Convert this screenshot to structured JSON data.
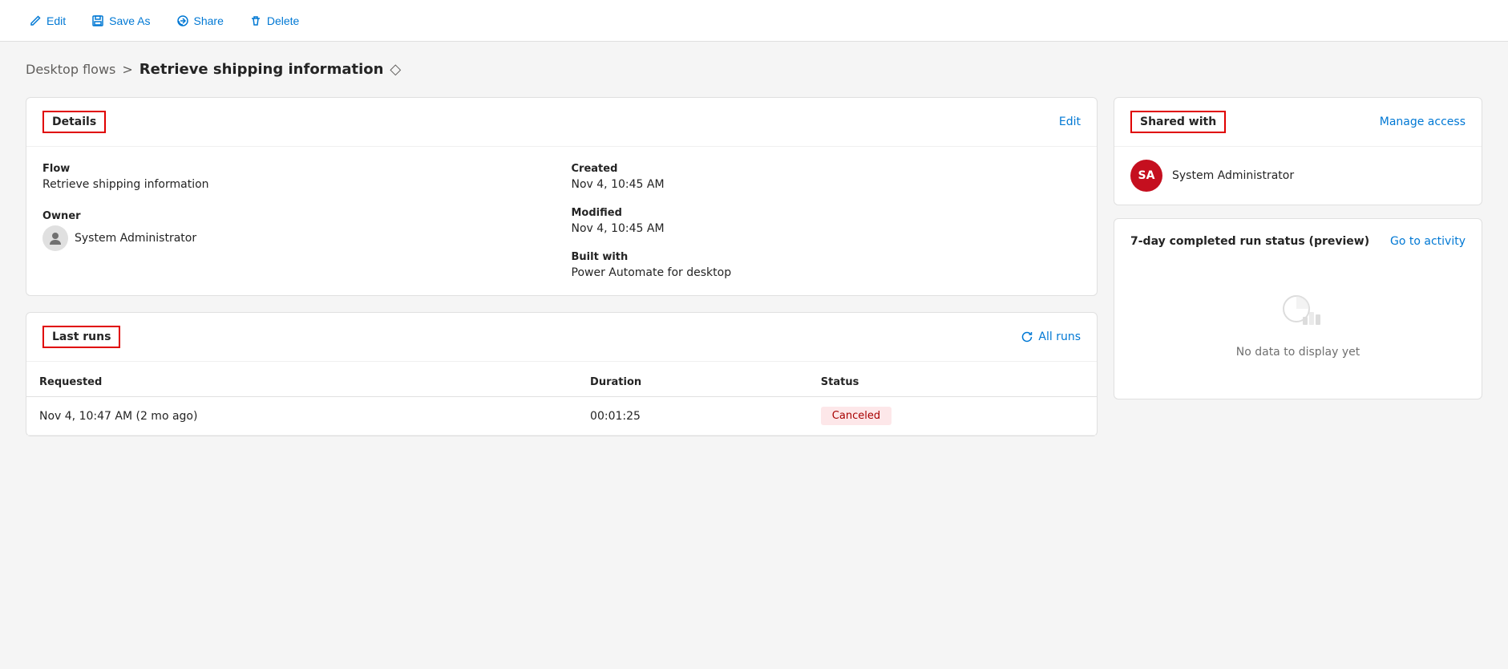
{
  "toolbar": {
    "edit_label": "Edit",
    "save_as_label": "Save As",
    "share_label": "Share",
    "delete_label": "Delete"
  },
  "breadcrumb": {
    "parent_label": "Desktop flows",
    "separator": ">",
    "current_label": "Retrieve shipping information"
  },
  "details_card": {
    "title": "Details",
    "edit_link": "Edit",
    "flow_label": "Flow",
    "flow_value": "Retrieve shipping information",
    "owner_label": "Owner",
    "owner_value": "System Administrator",
    "created_label": "Created",
    "created_value": "Nov 4, 10:45 AM",
    "modified_label": "Modified",
    "modified_value": "Nov 4, 10:45 AM",
    "built_with_label": "Built with",
    "built_with_value": "Power Automate for desktop"
  },
  "last_runs_card": {
    "title": "Last runs",
    "all_runs_label": "All runs",
    "columns": {
      "requested": "Requested",
      "duration": "Duration",
      "status": "Status"
    },
    "rows": [
      {
        "requested": "Nov 4, 10:47 AM (2 mo ago)",
        "duration": "00:01:25",
        "status": "Canceled"
      }
    ]
  },
  "shared_with_card": {
    "title": "Shared with",
    "manage_access_label": "Manage access",
    "users": [
      {
        "initials": "SA",
        "name": "System Administrator"
      }
    ]
  },
  "run_status": {
    "title": "7-day completed run status (preview)",
    "go_to_activity_label": "Go to activity",
    "no_data_label": "No data to display yet"
  }
}
